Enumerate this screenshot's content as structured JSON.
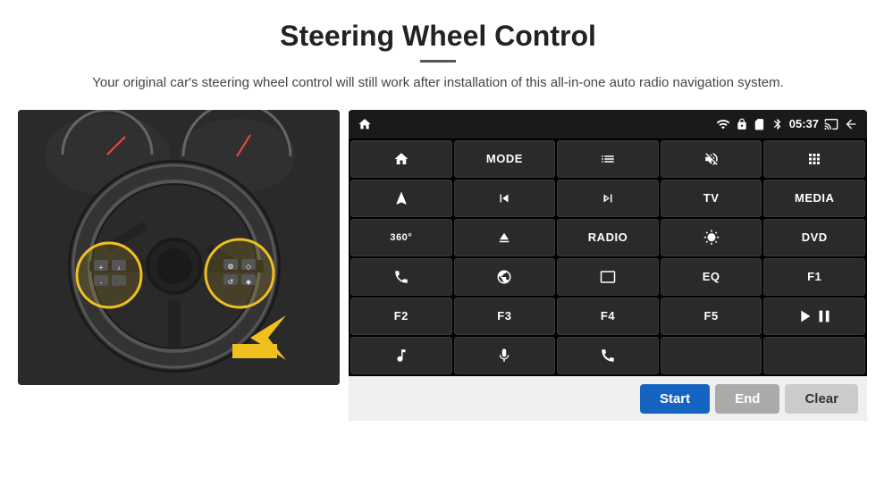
{
  "header": {
    "title": "Steering Wheel Control",
    "subtitle": "Your original car's steering wheel control will still work after installation of this all-in-one auto radio navigation system."
  },
  "status_bar": {
    "time": "05:37",
    "icons": [
      "wifi",
      "lock",
      "sim",
      "bluetooth",
      "cast",
      "back"
    ]
  },
  "grid_buttons": [
    {
      "id": "home",
      "label": "⌂",
      "icon": true
    },
    {
      "id": "mode",
      "label": "MODE",
      "icon": false
    },
    {
      "id": "list",
      "label": "≡",
      "icon": true
    },
    {
      "id": "mute",
      "label": "🔇",
      "icon": true
    },
    {
      "id": "apps",
      "label": "⋯",
      "icon": true
    },
    {
      "id": "nav",
      "label": "➤",
      "icon": true
    },
    {
      "id": "prev",
      "label": "⏮",
      "icon": true
    },
    {
      "id": "next",
      "label": "⏭",
      "icon": true
    },
    {
      "id": "tv",
      "label": "TV",
      "icon": false
    },
    {
      "id": "media",
      "label": "MEDIA",
      "icon": false
    },
    {
      "id": "360cam",
      "label": "360°",
      "icon": false
    },
    {
      "id": "eject",
      "label": "⏏",
      "icon": true
    },
    {
      "id": "radio",
      "label": "RADIO",
      "icon": false
    },
    {
      "id": "brightness",
      "label": "☀",
      "icon": true
    },
    {
      "id": "dvd",
      "label": "DVD",
      "icon": false
    },
    {
      "id": "phone",
      "label": "📞",
      "icon": true
    },
    {
      "id": "browser",
      "label": "🌐",
      "icon": true
    },
    {
      "id": "screen",
      "label": "▬",
      "icon": true
    },
    {
      "id": "eq",
      "label": "EQ",
      "icon": false
    },
    {
      "id": "f1",
      "label": "F1",
      "icon": false
    },
    {
      "id": "f2",
      "label": "F2",
      "icon": false
    },
    {
      "id": "f3",
      "label": "F3",
      "icon": false
    },
    {
      "id": "f4",
      "label": "F4",
      "icon": false
    },
    {
      "id": "f5",
      "label": "F5",
      "icon": false
    },
    {
      "id": "playpause",
      "label": "▶⏸",
      "icon": true
    },
    {
      "id": "music",
      "label": "♪",
      "icon": true
    },
    {
      "id": "mic",
      "label": "🎤",
      "icon": true
    },
    {
      "id": "callend",
      "label": "📵",
      "icon": true
    },
    {
      "id": "empty1",
      "label": "",
      "icon": false
    },
    {
      "id": "empty2",
      "label": "",
      "icon": false
    }
  ],
  "bottom_buttons": {
    "start_label": "Start",
    "end_label": "End",
    "clear_label": "Clear"
  },
  "colors": {
    "start_btn_bg": "#1565c0",
    "end_btn_bg": "#9e9e9e",
    "clear_btn_bg": "#cccccc",
    "panel_bg": "#1a1a1a",
    "grid_btn_bg": "#2d2d2d"
  }
}
